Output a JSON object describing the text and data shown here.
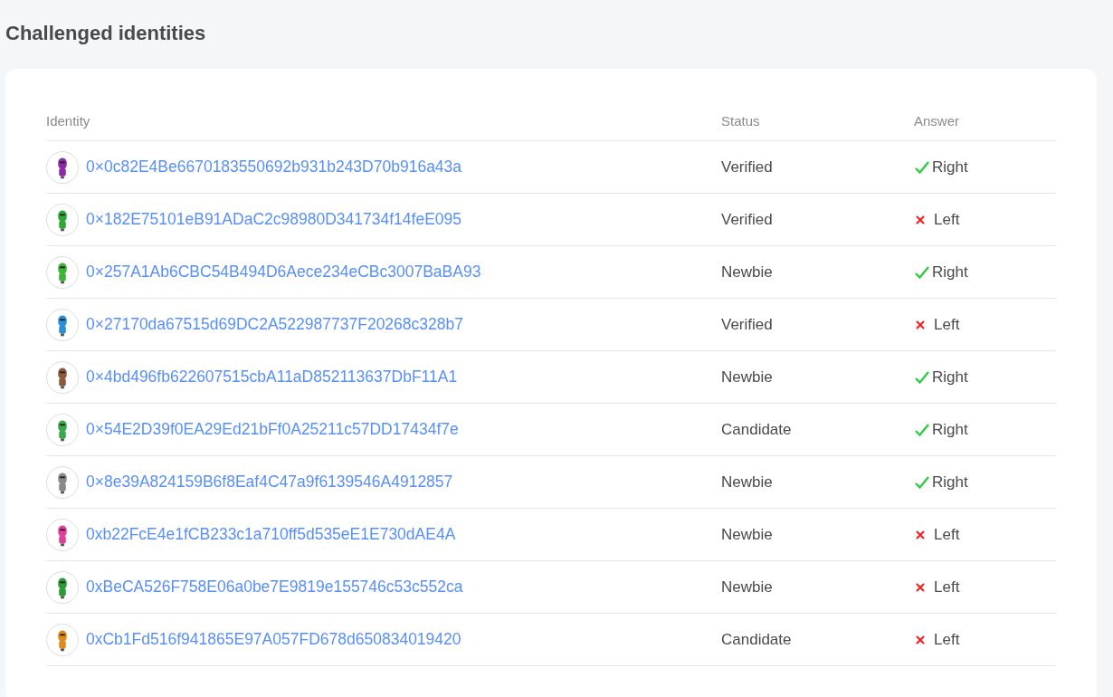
{
  "title": "Challenged identities",
  "table": {
    "columns": [
      "Identity",
      "Status",
      "Answer"
    ],
    "rows": [
      {
        "address": "0×0c82E4Be6670183550692b931b243D70b916a43a",
        "color": "#8e2aa8",
        "status": "Verified",
        "answer": "Right",
        "correct": true
      },
      {
        "address": "0×182E75101eB91ADaC2c98980D341734f14feE095",
        "color": "#2fa83a",
        "status": "Verified",
        "answer": "Left",
        "correct": false
      },
      {
        "address": "0×257A1Ab6CBC54B494D6Aece234eCBc3007BaBA93",
        "color": "#3fb23a",
        "status": "Newbie",
        "answer": "Right",
        "correct": true
      },
      {
        "address": "0×27170da67515d69DC2A522987737F20268c328b7",
        "color": "#2a8fd6",
        "status": "Verified",
        "answer": "Left",
        "correct": false
      },
      {
        "address": "0×4bd496fb622607515cbA11aD852113637DbF11A1",
        "color": "#8a5a3a",
        "status": "Newbie",
        "answer": "Right",
        "correct": true
      },
      {
        "address": "0×54E2D39f0EA29Ed21bFf0A25211c57DD17434f7e",
        "color": "#3aa84a",
        "status": "Candidate",
        "answer": "Right",
        "correct": true
      },
      {
        "address": "0×8e39A824159B6f8Eaf4C47a9f6139546A4912857",
        "color": "#8a8a8a",
        "status": "Newbie",
        "answer": "Right",
        "correct": true
      },
      {
        "address": "0xb22FcE4e1fCB233c1a710ff5d535eE1E730dAE4A",
        "color": "#e0409a",
        "status": "Newbie",
        "answer": "Left",
        "correct": false
      },
      {
        "address": "0xBeCA526F758E06a0be7E9819e155746c53c552ca",
        "color": "#2e9a36",
        "status": "Newbie",
        "answer": "Left",
        "correct": false
      },
      {
        "address": "0xCb1Fd516f941865E97A057FD678d650834019420",
        "color": "#e08a1e",
        "status": "Candidate",
        "answer": "Left",
        "correct": false
      }
    ]
  }
}
